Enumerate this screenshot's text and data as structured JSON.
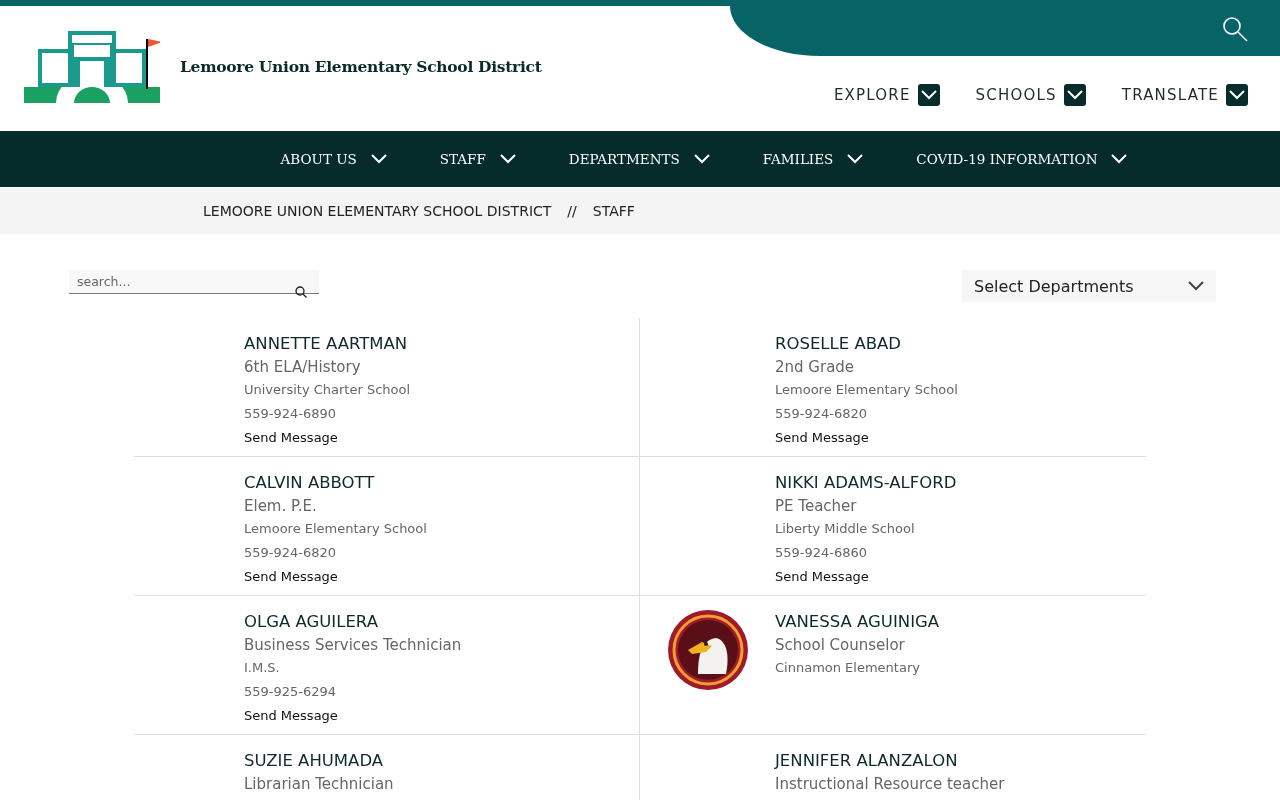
{
  "header": {
    "site_title": "Lemoore Union Elementary School District",
    "utility_menu": [
      {
        "label": "EXPLORE"
      },
      {
        "label": "SCHOOLS"
      },
      {
        "label": "TRANSLATE"
      }
    ]
  },
  "main_nav": [
    {
      "label": "ABOUT US"
    },
    {
      "label": "STAFF"
    },
    {
      "label": "DEPARTMENTS"
    },
    {
      "label": "FAMILIES"
    },
    {
      "label": "COVID-19 INFORMATION"
    }
  ],
  "breadcrumb": {
    "items": [
      "LEMOORE UNION ELEMENTARY SCHOOL DISTRICT",
      "STAFF"
    ],
    "separator": "//"
  },
  "search": {
    "placeholder": "search..."
  },
  "department_select": {
    "value": "Select Departments"
  },
  "staff": [
    {
      "name": "ANNETTE AARTMAN",
      "title": "6th ELA/History",
      "school": "University Charter School",
      "phone": "559-924-6890",
      "action": "Send Message"
    },
    {
      "name": "ROSELLE ABAD",
      "title": "2nd Grade",
      "school": "Lemoore Elementary School",
      "phone": "559-924-6820",
      "action": "Send Message"
    },
    {
      "name": "CALVIN ABBOTT",
      "title": "Elem. P.E.",
      "school": "Lemoore Elementary School",
      "phone": "559-924-6820",
      "action": "Send Message"
    },
    {
      "name": "NIKKI ADAMS-ALFORD",
      "title": "PE Teacher",
      "school": "Liberty Middle School",
      "phone": "559-924-6860",
      "action": "Send Message"
    },
    {
      "name": "OLGA AGUILERA",
      "title": "Business Services Technician",
      "school": "I.M.S.",
      "phone": "559-925-6294",
      "action": "Send Message"
    },
    {
      "name": "VANESSA AGUINIGA",
      "title": "School Counselor",
      "school": "Cinnamon Elementary"
    },
    {
      "name": "SUZIE AHUMADA",
      "title": "Librarian Technician"
    },
    {
      "name": "JENNIFER ALANZALON",
      "title": "Instructional Resource teacher"
    }
  ]
}
